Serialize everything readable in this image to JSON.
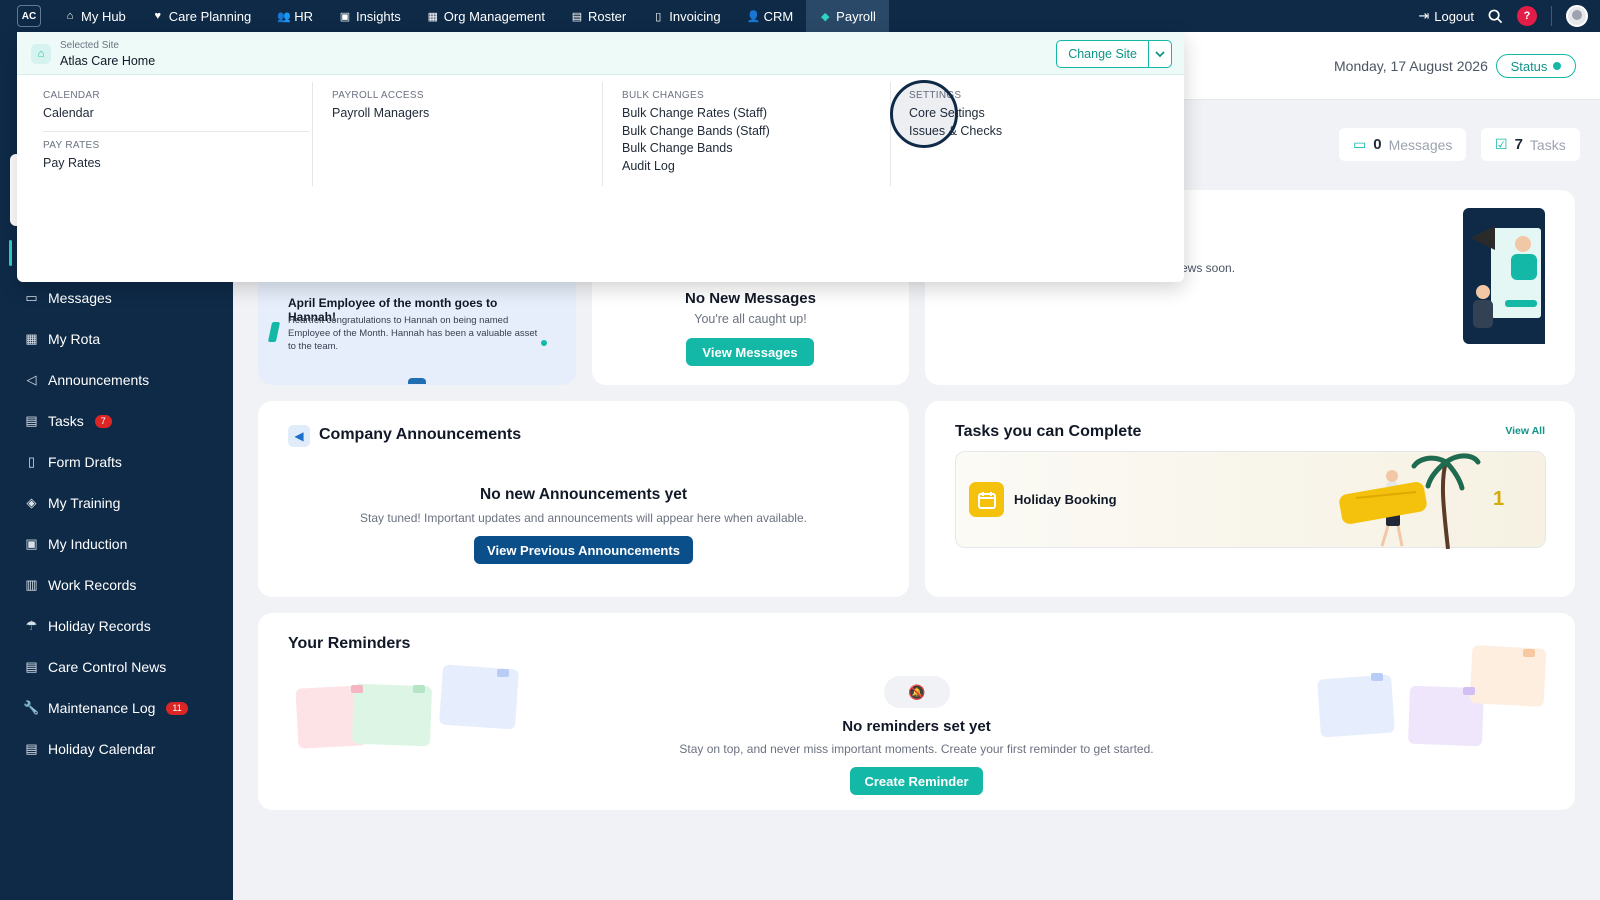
{
  "nav": {
    "logo": "AC",
    "items": [
      {
        "label": "My Hub",
        "icon": "home-icon",
        "glyph": "⌂"
      },
      {
        "label": "Care Planning",
        "icon": "heart-icon",
        "glyph": "♥"
      },
      {
        "label": "HR",
        "icon": "users-icon",
        "glyph": "👥"
      },
      {
        "label": "Insights",
        "icon": "chart-icon",
        "glyph": "▣"
      },
      {
        "label": "Org Management",
        "icon": "building-icon",
        "glyph": "▦"
      },
      {
        "label": "Roster",
        "icon": "calendar-icon",
        "glyph": "▤"
      },
      {
        "label": "Invoicing",
        "icon": "invoice-icon",
        "glyph": "▯"
      },
      {
        "label": "CRM",
        "icon": "contacts-icon",
        "glyph": "👤"
      },
      {
        "label": "Payroll",
        "icon": "payroll-icon",
        "glyph": "◆"
      }
    ],
    "logout": "Logout",
    "help": "?"
  },
  "header": {
    "date": "Monday, 17 August 2026",
    "status": "Status",
    "messages_count": "0",
    "messages_label": "Messages",
    "tasks_count": "7",
    "tasks_label": "Tasks"
  },
  "sidebar": {
    "items": [
      {
        "label": "Messages",
        "icon": "message-icon",
        "glyph": "▭",
        "badge": ""
      },
      {
        "label": "My Rota",
        "icon": "grid-calendar-icon",
        "glyph": "▦",
        "badge": ""
      },
      {
        "label": "Announcements",
        "icon": "megaphone-icon",
        "glyph": "◁",
        "badge": ""
      },
      {
        "label": "Tasks",
        "icon": "calendar-icon",
        "glyph": "▤",
        "badge": "7"
      },
      {
        "label": "Form Drafts",
        "icon": "clipboard-icon",
        "glyph": "▯",
        "badge": ""
      },
      {
        "label": "My Training",
        "icon": "graduation-cap-icon",
        "glyph": "◈",
        "badge": ""
      },
      {
        "label": "My Induction",
        "icon": "checklist-icon",
        "glyph": "▣",
        "badge": ""
      },
      {
        "label": "Work Records",
        "icon": "briefcase-icon",
        "glyph": "▥",
        "badge": ""
      },
      {
        "label": "Holiday Records",
        "icon": "umbrella-icon",
        "glyph": "☂",
        "badge": ""
      },
      {
        "label": "Care Control News",
        "icon": "news-icon",
        "glyph": "▤",
        "badge": ""
      },
      {
        "label": "Maintenance Log",
        "icon": "wrench-icon",
        "glyph": "🔧",
        "badge": "11"
      },
      {
        "label": "Holiday Calendar",
        "icon": "calendar-icon",
        "glyph": "▤",
        "badge": ""
      }
    ]
  },
  "menu": {
    "selected_site_caption": "Selected Site",
    "selected_site": "Atlas Care Home",
    "change_site": "Change Site",
    "calendar_caption": "CALENDAR",
    "calendar_link": "Calendar",
    "pay_rates_caption": "PAY RATES",
    "pay_rates_link": "Pay Rates",
    "payroll_access_caption": "PAYROLL ACCESS",
    "payroll_managers": "Payroll Managers",
    "bulk_caption": "BULK CHANGES",
    "bulk_links": [
      "Bulk Change Rates (Staff)",
      "Bulk Change Bands (Staff)",
      "Bulk Change Bands",
      "Audit Log"
    ],
    "settings_caption": "SETTINGS",
    "settings_links": [
      "Core Settings",
      "Issues & Checks"
    ]
  },
  "employee": {
    "heading": "April Employee of the month goes to Hannah!",
    "body": "Heartfelt congratulations to Hannah on being named Employee of the Month. Hannah has been a valuable asset to the team."
  },
  "messages_card": {
    "title": "No New Messages",
    "subtitle": "You're all caught up!",
    "button": "View Messages"
  },
  "news_card": {
    "text_fragment": "ews soon."
  },
  "announcements": {
    "title": "Company Announcements",
    "empty_title": "No new Announcements yet",
    "empty_text": "Stay tuned! Important updates and announcements will appear here when available.",
    "button": "View Previous Announcements"
  },
  "tasks_card": {
    "title": "Tasks you can Complete",
    "view_all": "View All",
    "task_label": "Holiday Booking",
    "task_count": "1"
  },
  "reminders": {
    "title": "Your Reminders",
    "empty_title": "No reminders set yet",
    "empty_text": "Stay on top, and never miss important moments. Create your first reminder to get started.",
    "button": "Create Reminder"
  },
  "colors": {
    "navy": "#0e2a47",
    "teal": "#14b8a6",
    "badge_red": "#dc2626",
    "button_blue": "#0b4f8a"
  }
}
